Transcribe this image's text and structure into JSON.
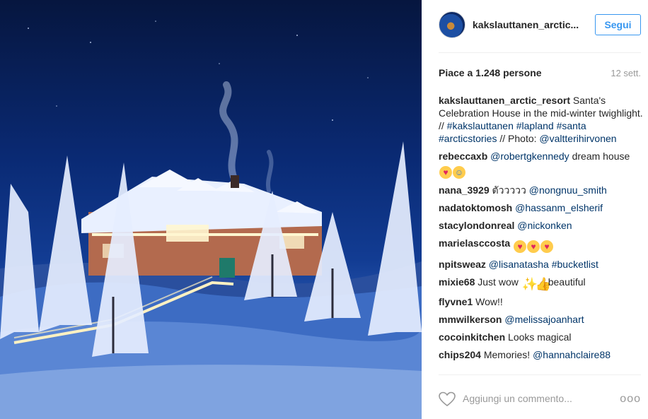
{
  "post": {
    "author": "kakslauttanen_arctic...",
    "follow_label": "Segui",
    "likes_text": "Piace a 1.248 persone",
    "date": "12 sett."
  },
  "caption": {
    "user": "kakslauttanen_arctic_resort",
    "text": "Santa's Celebration House in the mid-winter twighlight. //",
    "tags": [
      "#kakslauttanen",
      "#lapland",
      "#santa",
      "#arcticstories"
    ],
    "photo_label": "// Photo:",
    "photo_credit": "@valtterihirvonen"
  },
  "comments": [
    {
      "user": "rebeccaxb",
      "mention": "@robertgkennedy",
      "text": "dream house"
    },
    {
      "user": "nana_3929",
      "text": "ตัววววว",
      "mention": "@nongnuu_smith"
    },
    {
      "user": "nadatoktomosh",
      "mention": "@hassanm_elsherif"
    },
    {
      "user": "stacylondonreal",
      "mention": "@nickonken"
    },
    {
      "user": "marielasccosta"
    },
    {
      "user": "npitsweaz",
      "mention": "@lisanatasha",
      "tag": "#bucketlist"
    },
    {
      "user": "mixie68",
      "text": "Just wow",
      "text2": "beautiful"
    },
    {
      "user": "flyvne1",
      "text": "Wow!!"
    },
    {
      "user": "mmwilkerson",
      "mention": "@melissajoanhart"
    },
    {
      "user": "cocoinkitchen",
      "text": "Looks magical"
    },
    {
      "user": "chips204",
      "text": "Memories!",
      "mention": "@hannahclaire88"
    }
  ],
  "footer": {
    "comment_placeholder": "Aggiungi un commento...",
    "more_label": "ooo"
  },
  "icons": {
    "like": "heart-outline-icon",
    "more": "more-options-icon",
    "emoji_heart_eyes": "heart-eyes-emoji",
    "emoji_laugh": "tears-of-joy-emoji",
    "emoji_sparkle": "sparkle-emoji",
    "emoji_thumbs": "thumbs-up-emoji"
  },
  "colors": {
    "link": "#003569",
    "accent": "#3897f0",
    "muted": "#999999"
  }
}
